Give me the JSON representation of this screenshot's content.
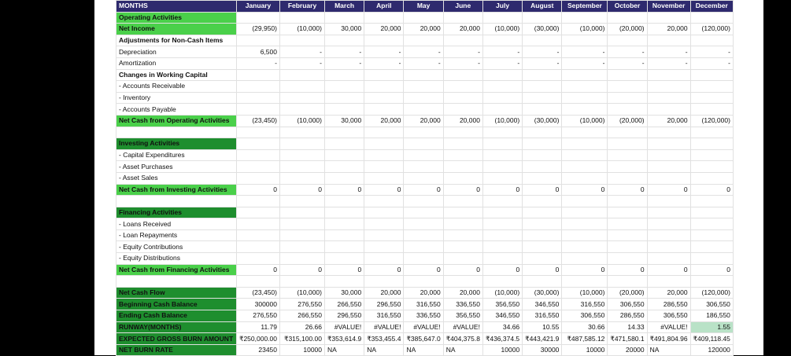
{
  "sheet": {
    "header_label": "MONTHS",
    "months": [
      "January",
      "February",
      "March",
      "April",
      "May",
      "June",
      "July",
      "August",
      "September",
      "October",
      "November",
      "December"
    ],
    "rows": [
      {
        "name": "operating-activities",
        "label": "Operating Activities",
        "style": "g-light",
        "values": []
      },
      {
        "name": "net-income",
        "label": "Net Income",
        "style": "g-light",
        "values": [
          "(29,950)",
          "(10,000)",
          "30,000",
          "20,000",
          "20,000",
          "20,000",
          "(10,000)",
          "(30,000)",
          "(10,000)",
          "(20,000)",
          "20,000",
          "(120,000)"
        ]
      },
      {
        "name": "adjustments",
        "label": "Adjustments for Non-Cash Items",
        "style": "bold",
        "values": []
      },
      {
        "name": "depreciation",
        "label": "Depreciation",
        "style": "",
        "values": [
          "6,500",
          "-",
          "-",
          "-",
          "-",
          "-",
          "-",
          "-",
          "-",
          "-",
          "-",
          "-"
        ]
      },
      {
        "name": "amortization",
        "label": "Amortization",
        "style": "",
        "values": [
          "-",
          "-",
          "-",
          "-",
          "-",
          "-",
          "-",
          "-",
          "-",
          "-",
          "-",
          "-"
        ]
      },
      {
        "name": "changes-working-capital",
        "label": "Changes in Working Capital",
        "style": "bold",
        "values": []
      },
      {
        "name": "accounts-receivable",
        "label": "- Accounts Receivable",
        "style": "",
        "values": []
      },
      {
        "name": "inventory",
        "label": "- Inventory",
        "style": "",
        "values": []
      },
      {
        "name": "accounts-payable",
        "label": "- Accounts Payable",
        "style": "",
        "values": []
      },
      {
        "name": "net-cash-operating",
        "label": "Net Cash from Operating Activities",
        "style": "g-light",
        "values": [
          "(23,450)",
          "(10,000)",
          "30,000",
          "20,000",
          "20,000",
          "20,000",
          "(10,000)",
          "(30,000)",
          "(10,000)",
          "(20,000)",
          "20,000",
          "(120,000)"
        ]
      },
      {
        "name": "blank-1",
        "label": "",
        "style": "",
        "values": []
      },
      {
        "name": "investing-activities",
        "label": "Investing Activities",
        "style": "g-dark",
        "values": []
      },
      {
        "name": "capital-expenditures",
        "label": "- Capital Expenditures",
        "style": "",
        "values": []
      },
      {
        "name": "asset-purchases",
        "label": "- Asset Purchases",
        "style": "",
        "values": []
      },
      {
        "name": "asset-sales",
        "label": "- Asset Sales",
        "style": "",
        "values": []
      },
      {
        "name": "net-cash-investing",
        "label": "Net Cash from Investing Activities",
        "style": "g-light",
        "values": [
          "0",
          "0",
          "0",
          "0",
          "0",
          "0",
          "0",
          "0",
          "0",
          "0",
          "0",
          "0"
        ]
      },
      {
        "name": "blank-2",
        "label": "",
        "style": "",
        "values": []
      },
      {
        "name": "financing-activities",
        "label": "Financing Activities",
        "style": "g-dark",
        "values": []
      },
      {
        "name": "loans-received",
        "label": "- Loans Received",
        "style": "",
        "values": []
      },
      {
        "name": "loan-repayments",
        "label": "- Loan Repayments",
        "style": "",
        "values": []
      },
      {
        "name": "equity-contributions",
        "label": "- Equity Contributions",
        "style": "",
        "values": []
      },
      {
        "name": "equity-distributions",
        "label": "- Equity Distributions",
        "style": "",
        "values": []
      },
      {
        "name": "net-cash-financing",
        "label": "Net Cash from Financing Activities",
        "style": "g-light",
        "values": [
          "0",
          "0",
          "0",
          "0",
          "0",
          "0",
          "0",
          "0",
          "0",
          "0",
          "0",
          "0"
        ]
      },
      {
        "name": "blank-3",
        "label": "",
        "style": "",
        "values": []
      },
      {
        "name": "net-cash-flow",
        "label": "Net Cash Flow",
        "style": "g-dark",
        "values": [
          "(23,450)",
          "(10,000)",
          "30,000",
          "20,000",
          "20,000",
          "20,000",
          "(10,000)",
          "(30,000)",
          "(10,000)",
          "(20,000)",
          "20,000",
          "(120,000)"
        ]
      },
      {
        "name": "beginning-cash",
        "label": "Beginning Cash Balance",
        "style": "g-dark",
        "values": [
          "300000",
          "276,550",
          "266,550",
          "296,550",
          "316,550",
          "336,550",
          "356,550",
          "346,550",
          "316,550",
          "306,550",
          "286,550",
          "306,550"
        ]
      },
      {
        "name": "ending-cash",
        "label": "Ending Cash Balance",
        "style": "g-dark",
        "values": [
          "276,550",
          "266,550",
          "296,550",
          "316,550",
          "336,550",
          "356,550",
          "346,550",
          "316,550",
          "306,550",
          "286,550",
          "306,550",
          "186,550"
        ]
      },
      {
        "name": "runway",
        "label": "RUNWAY(MONTHS)",
        "style": "g-dark",
        "values": [
          "11.79",
          "26.66",
          "#VALUE!",
          "#VALUE!",
          "#VALUE!",
          "#VALUE!",
          "34.66",
          "10.55",
          "30.66",
          "14.33",
          "#VALUE!",
          "1.55"
        ]
      },
      {
        "name": "gross-burn",
        "label": "EXPECTED GROSS BURN AMOUNT",
        "style": "g-dark",
        "values": [
          "₹250,000.00",
          "₹315,100.00",
          "₹353,614.9",
          "₹353,455.4",
          "₹385,647.0",
          "₹404,375.8",
          "₹436,374.5",
          "₹443,421.9",
          "₹487,585.12",
          "₹471,580.1",
          "₹491,804.96",
          "₹409,118.45"
        ]
      },
      {
        "name": "net-burn",
        "label": "NET BURN RATE",
        "style": "g-dark",
        "values": [
          "23450",
          "10000",
          "NA",
          "NA",
          "NA",
          "NA",
          "10000",
          "30000",
          "10000",
          "20000",
          "NA",
          "120000"
        ]
      }
    ],
    "highlight": {
      "row": "runway",
      "col": 11
    }
  }
}
